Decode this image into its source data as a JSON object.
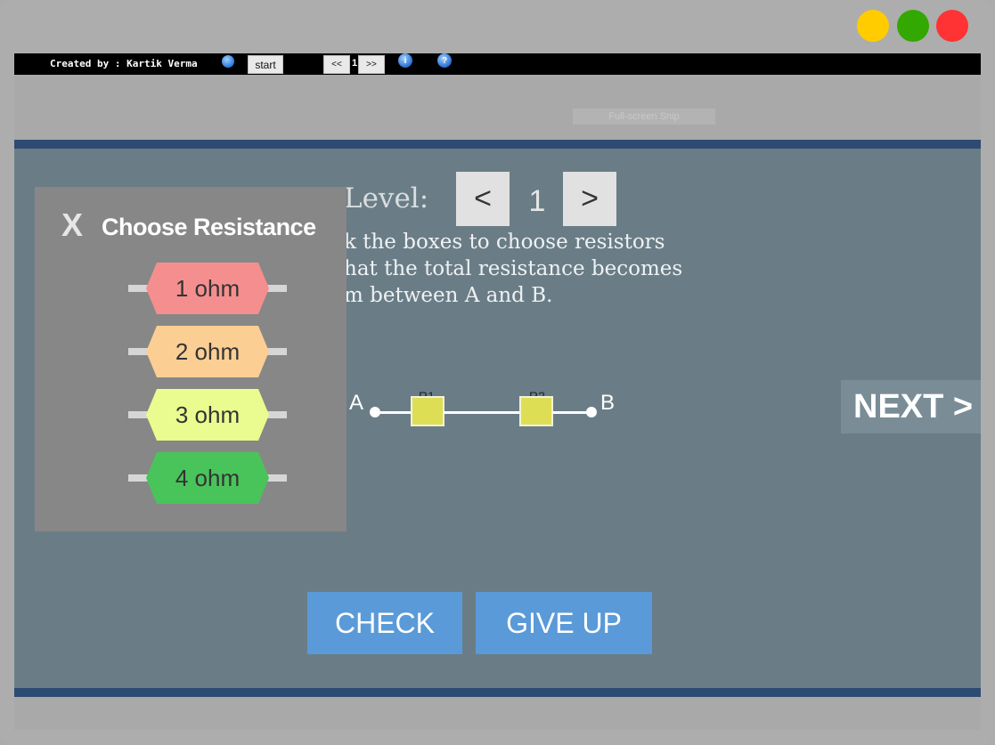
{
  "window_controls": [
    "minimize",
    "zoom",
    "close"
  ],
  "toolbar": {
    "creator": "Created by : Kartik Verma",
    "start_label": "start",
    "prev_label": "<<",
    "page_number": "1",
    "next_label": ">>",
    "info_icon": "info-icon",
    "help_icon": "help-icon"
  },
  "fullscreen_label": "Full-screen Snip",
  "level": {
    "label": "Level:",
    "value": "1",
    "prev": "<",
    "next": ">"
  },
  "instructions": [
    "k the boxes to choose resistors",
    "hat the total resistance becomes",
    "m between A and B."
  ],
  "circuit": {
    "node_a": "A",
    "node_b": "B",
    "r1": "R1",
    "r2": "R2"
  },
  "next_button": "NEXT >",
  "check_button": "CHECK",
  "giveup_button": "GIVE UP",
  "resistance_panel": {
    "close": "X",
    "title": "Choose Resistance",
    "options": [
      {
        "label": "1 ohm",
        "color": "#f58f8f"
      },
      {
        "label": "2 ohm",
        "color": "#fbce93"
      },
      {
        "label": "3 ohm",
        "color": "#eafc8f"
      },
      {
        "label": "4 ohm",
        "color": "#49c45a"
      }
    ]
  },
  "colors": {
    "stage": "#6a7d86",
    "stage_border": "#2d4a72",
    "action_button": "#5a9ad8",
    "resistor_box": "#dede55"
  }
}
